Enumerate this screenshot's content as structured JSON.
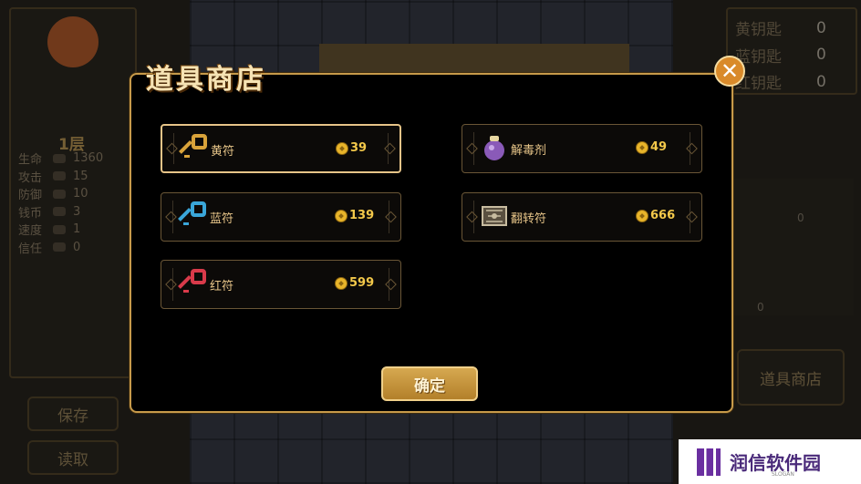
{
  "background": {
    "floor": "1层",
    "stats": [
      {
        "label": "生命",
        "value": "1360"
      },
      {
        "label": "攻击",
        "value": "15"
      },
      {
        "label": "防御",
        "value": "10"
      },
      {
        "label": "钱币",
        "value": "3"
      },
      {
        "label": "速度",
        "value": "1"
      },
      {
        "label": "信任",
        "value": "0"
      }
    ],
    "save_label": "保存",
    "load_label": "读取",
    "keys": [
      {
        "label": "黄钥匙",
        "value": "0"
      },
      {
        "label": "蓝钥匙",
        "value": "0"
      },
      {
        "label": "红钥匙",
        "value": "0"
      }
    ],
    "inventory_counts": [
      "0",
      "0"
    ],
    "shop_button_label": "道具商店"
  },
  "shop": {
    "title": "道具商店",
    "close_glyph": "✕",
    "confirm_label": "确定",
    "items": [
      {
        "name": "黄符",
        "price": "39",
        "icon": "yellow-key-icon",
        "color": "#d9a33a",
        "selected": true
      },
      {
        "name": "蓝符",
        "price": "139",
        "icon": "blue-key-icon",
        "color": "#3aa6d9"
      },
      {
        "name": "红符",
        "price": "599",
        "icon": "red-key-icon",
        "color": "#d93a4a"
      },
      {
        "name": "解毒剂",
        "price": "49",
        "icon": "antidote-potion-icon",
        "color": "#8a5ab8"
      },
      {
        "name": "翻转符",
        "price": "666",
        "icon": "flip-tile-icon",
        "color": "#9a8a70"
      }
    ]
  },
  "watermark": {
    "text": "润信软件园",
    "slogan": "SLOGAN"
  }
}
